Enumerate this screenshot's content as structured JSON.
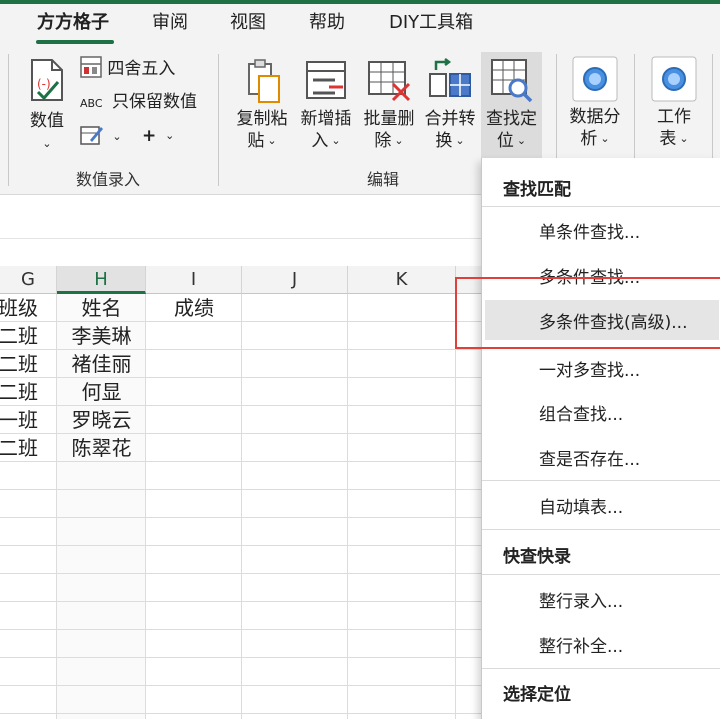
{
  "tabs": [
    "方方格子",
    "审阅",
    "视图",
    "帮助",
    "DIY工具箱"
  ],
  "ribbon": {
    "value_group": {
      "value_btn": "数值",
      "round_btn": "四舍五入",
      "keep_value_btn": "只保留数值",
      "plus": "+",
      "label": "数值录入"
    },
    "edit_group": {
      "copy_paste": [
        "复制粘",
        "贴"
      ],
      "insert": [
        "新增插",
        "入"
      ],
      "batch_delete": [
        "批量删",
        "除"
      ],
      "merge_convert": [
        "合并转",
        "换"
      ],
      "find_locate": [
        "查找定",
        "位"
      ],
      "label": "编辑"
    },
    "data_analysis": [
      "数据分",
      "析"
    ],
    "worksheet": [
      "工作",
      "表"
    ],
    "abc": "ABC"
  },
  "grid": {
    "columns": [
      "G",
      "H",
      "I",
      "J",
      "K"
    ],
    "rows": [
      [
        "班级",
        "姓名",
        "成绩"
      ],
      [
        "二班",
        "李美琳",
        ""
      ],
      [
        "二班",
        "褚佳丽",
        ""
      ],
      [
        "二班",
        "何显",
        ""
      ],
      [
        "一班",
        "罗晓云",
        ""
      ],
      [
        "二班",
        "陈翠花",
        ""
      ]
    ]
  },
  "dropdown": {
    "section1": "查找匹配",
    "items1": [
      "单条件查找...",
      "多条件查找...",
      "多条件查找(高级)...",
      "一对多查找...",
      "组合查找...",
      "查是否存在...",
      "自动填表..."
    ],
    "section2": "快查快录",
    "items2": [
      "整行录入...",
      "整行补全..."
    ],
    "section3": "选择定位"
  },
  "colors": {
    "accent": "#1e7145",
    "highlight": "#e0403a"
  }
}
